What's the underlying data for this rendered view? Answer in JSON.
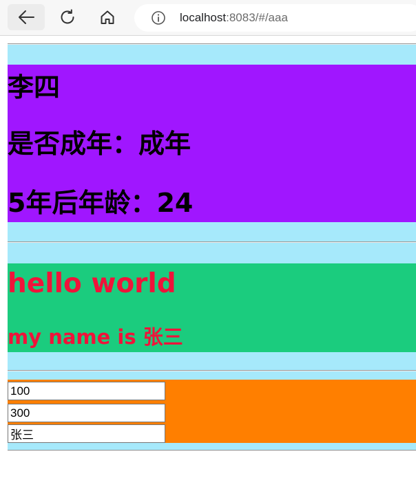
{
  "browser": {
    "url_host": "localhost",
    "url_rest": ":8083/#/aaa"
  },
  "person": {
    "name": "李四",
    "adult_line": "是否成年：成年",
    "age_line": "5年后年龄：24"
  },
  "greeting": {
    "hello": "hello world",
    "my_name": "my name is 张三"
  },
  "inputs": {
    "first": "100",
    "second": "300",
    "third": "张三"
  },
  "colors": {
    "outer_band": "#a6e9fb",
    "purple_block": "#a016ff",
    "green_block": "#1bcc7e",
    "orange_block": "#ff7f00",
    "greeting_text": "#f0133a"
  }
}
